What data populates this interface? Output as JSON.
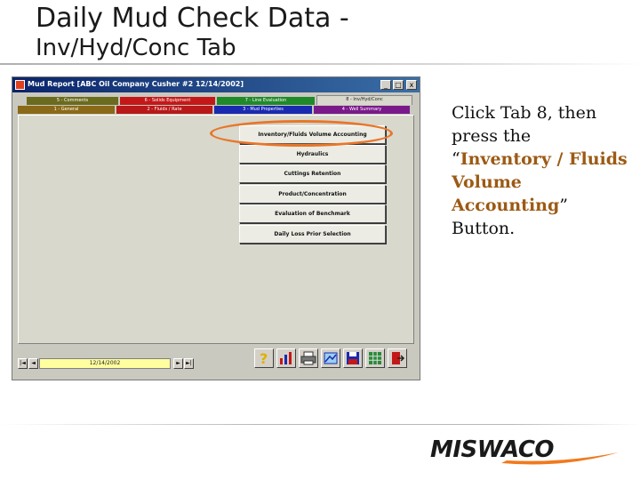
{
  "slide": {
    "title": "Daily Mud Check Data -",
    "subtitle": "Inv/Hyd/Conc Tab"
  },
  "window": {
    "title": "Mud Report [ABC Oil Company  Cusher #2  12/14/2002]",
    "min_label": "_",
    "max_label": "□",
    "close_label": "x",
    "tabs_top": [
      {
        "label": "5 - Comments",
        "color": "#6b6b1e"
      },
      {
        "label": "6 - Solids Equipment",
        "color": "#c41818"
      },
      {
        "label": "7 - Line Evaluation",
        "color": "#1f8a2a"
      },
      {
        "label": "8 - Inv/Hyd/Conc",
        "color": "#d8d8cc",
        "active": true
      }
    ],
    "tabs_bottom": [
      {
        "label": "1 - General",
        "color": "#8a6a18"
      },
      {
        "label": "2 - Fluids / Rate",
        "color": "#b81818"
      },
      {
        "label": "3 - Mud Properties",
        "color": "#1a2ab0"
      },
      {
        "label": "4 - Well Summary",
        "color": "#7a1a8a"
      }
    ],
    "buttons": [
      "Inventory/Fluids Volume Accounting",
      "Hydraulics",
      "Cuttings Retention",
      "Product/Concentration",
      "Evaluation of Benchmark",
      "Daily Loss Prior Selection"
    ],
    "nav": {
      "first": "|◄",
      "prev": "◄",
      "date": "12/14/2002",
      "next": "►",
      "last": "►|"
    },
    "toolbar_icons": [
      "help-icon",
      "chart-icon",
      "print-icon",
      "report-icon",
      "save-icon",
      "grid-icon",
      "exit-icon"
    ]
  },
  "instruction": {
    "prefix": "Click Tab 8, then press the “",
    "highlight": "Inventory / Fluids Volume Accounting",
    "suffix": "” Button."
  },
  "logo": {
    "text": "MISWACO",
    "accent_color": "#f07a1e"
  }
}
